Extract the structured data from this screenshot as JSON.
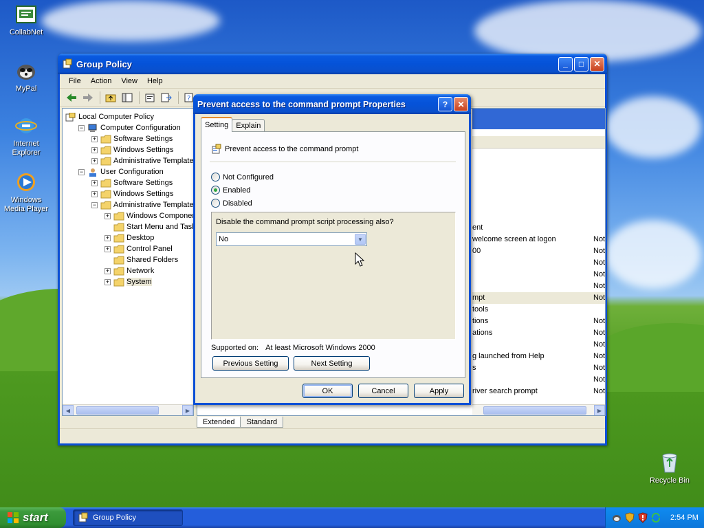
{
  "desktop": {
    "icons": [
      {
        "label": "CollabNet",
        "icon": "collabnet-icon"
      },
      {
        "label": "MyPal",
        "icon": "mypal-icon"
      },
      {
        "label": "Internet Explorer",
        "icon": "internet-explorer-icon"
      },
      {
        "label": "Windows Media Player",
        "icon": "media-player-icon"
      },
      {
        "label": "Recycle Bin",
        "icon": "recycle-bin-icon"
      }
    ]
  },
  "window": {
    "title": "Group Policy",
    "menu": [
      "File",
      "Action",
      "View",
      "Help"
    ],
    "tree": [
      {
        "label": "Local Computer Policy",
        "level": 0,
        "expander": ""
      },
      {
        "label": "Computer Configuration",
        "level": 1,
        "expander": "−"
      },
      {
        "label": "Software Settings",
        "level": 2,
        "expander": "+"
      },
      {
        "label": "Windows Settings",
        "level": 2,
        "expander": "+"
      },
      {
        "label": "Administrative Templates",
        "level": 2,
        "expander": "+"
      },
      {
        "label": "User Configuration",
        "level": 1,
        "expander": "−"
      },
      {
        "label": "Software Settings",
        "level": 2,
        "expander": "+"
      },
      {
        "label": "Windows Settings",
        "level": 2,
        "expander": "+"
      },
      {
        "label": "Administrative Templates",
        "level": 2,
        "expander": "−"
      },
      {
        "label": "Windows Components",
        "level": 3,
        "expander": "+"
      },
      {
        "label": "Start Menu and Taskbar",
        "level": 3,
        "expander": ""
      },
      {
        "label": "Desktop",
        "level": 3,
        "expander": "+"
      },
      {
        "label": "Control Panel",
        "level": 3,
        "expander": "+"
      },
      {
        "label": "Shared Folders",
        "level": 3,
        "expander": ""
      },
      {
        "label": "Network",
        "level": 3,
        "expander": "+"
      },
      {
        "label": "System",
        "level": 3,
        "expander": "+"
      }
    ],
    "settings_rows": [
      {
        "name": "ent",
        "state": ""
      },
      {
        "name": "welcome screen at logon",
        "state": "Not"
      },
      {
        "name": "00",
        "state": "Not"
      },
      {
        "name": "",
        "state": "Not"
      },
      {
        "name": "",
        "state": "Not"
      },
      {
        "name": "",
        "state": "Not"
      },
      {
        "name": "mpt",
        "state": "Not"
      },
      {
        "name": "tools",
        "state": ""
      },
      {
        "name": "tions",
        "state": "Not"
      },
      {
        "name": "ations",
        "state": "Not"
      },
      {
        "name": "",
        "state": "Not"
      },
      {
        "name": "g launched from Help",
        "state": "Not"
      },
      {
        "name": "s",
        "state": "Not"
      },
      {
        "name": "",
        "state": "Not"
      },
      {
        "name": "river search prompt",
        "state": "Not"
      }
    ],
    "view_tabs": [
      "Extended",
      "Standard"
    ]
  },
  "dialog": {
    "title": "Prevent access to the command prompt Properties",
    "tabs": [
      "Setting",
      "Explain"
    ],
    "policy_name": "Prevent access to the command prompt",
    "radios": [
      {
        "label": "Not Configured",
        "checked": false
      },
      {
        "label": "Enabled",
        "checked": true
      },
      {
        "label": "Disabled",
        "checked": false
      }
    ],
    "option_question": "Disable the command prompt script processing also?",
    "option_value": "No",
    "supported_label": "Supported on:",
    "supported_value": "At least Microsoft Windows 2000",
    "prev_button": "Previous Setting",
    "next_button": "Next Setting",
    "ok_button": "OK",
    "cancel_button": "Cancel",
    "apply_button": "Apply"
  },
  "taskbar": {
    "start_label": "start",
    "task_label": "Group Policy",
    "clock": "2:54 PM"
  }
}
